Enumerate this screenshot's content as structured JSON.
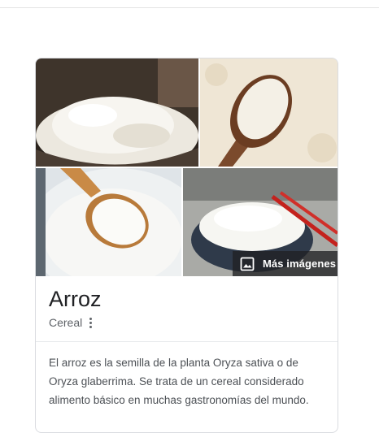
{
  "knowledge_panel": {
    "more_images_label": "Más imágenes",
    "title": "Arroz",
    "subtitle": "Cereal",
    "description": "El arroz es la semilla de la planta Oryza sativa o de Oryza glaberrima. Se trata de un cereal considerado alimento básico en muchas gastronomías del mundo.",
    "icons": {
      "more_images": "image-icon",
      "subtitle_menu": "more-vert-icon"
    },
    "colors": {
      "title": "#202124",
      "subtitle": "#5f6368",
      "description": "#4d5156",
      "overlay": "#202124"
    }
  }
}
